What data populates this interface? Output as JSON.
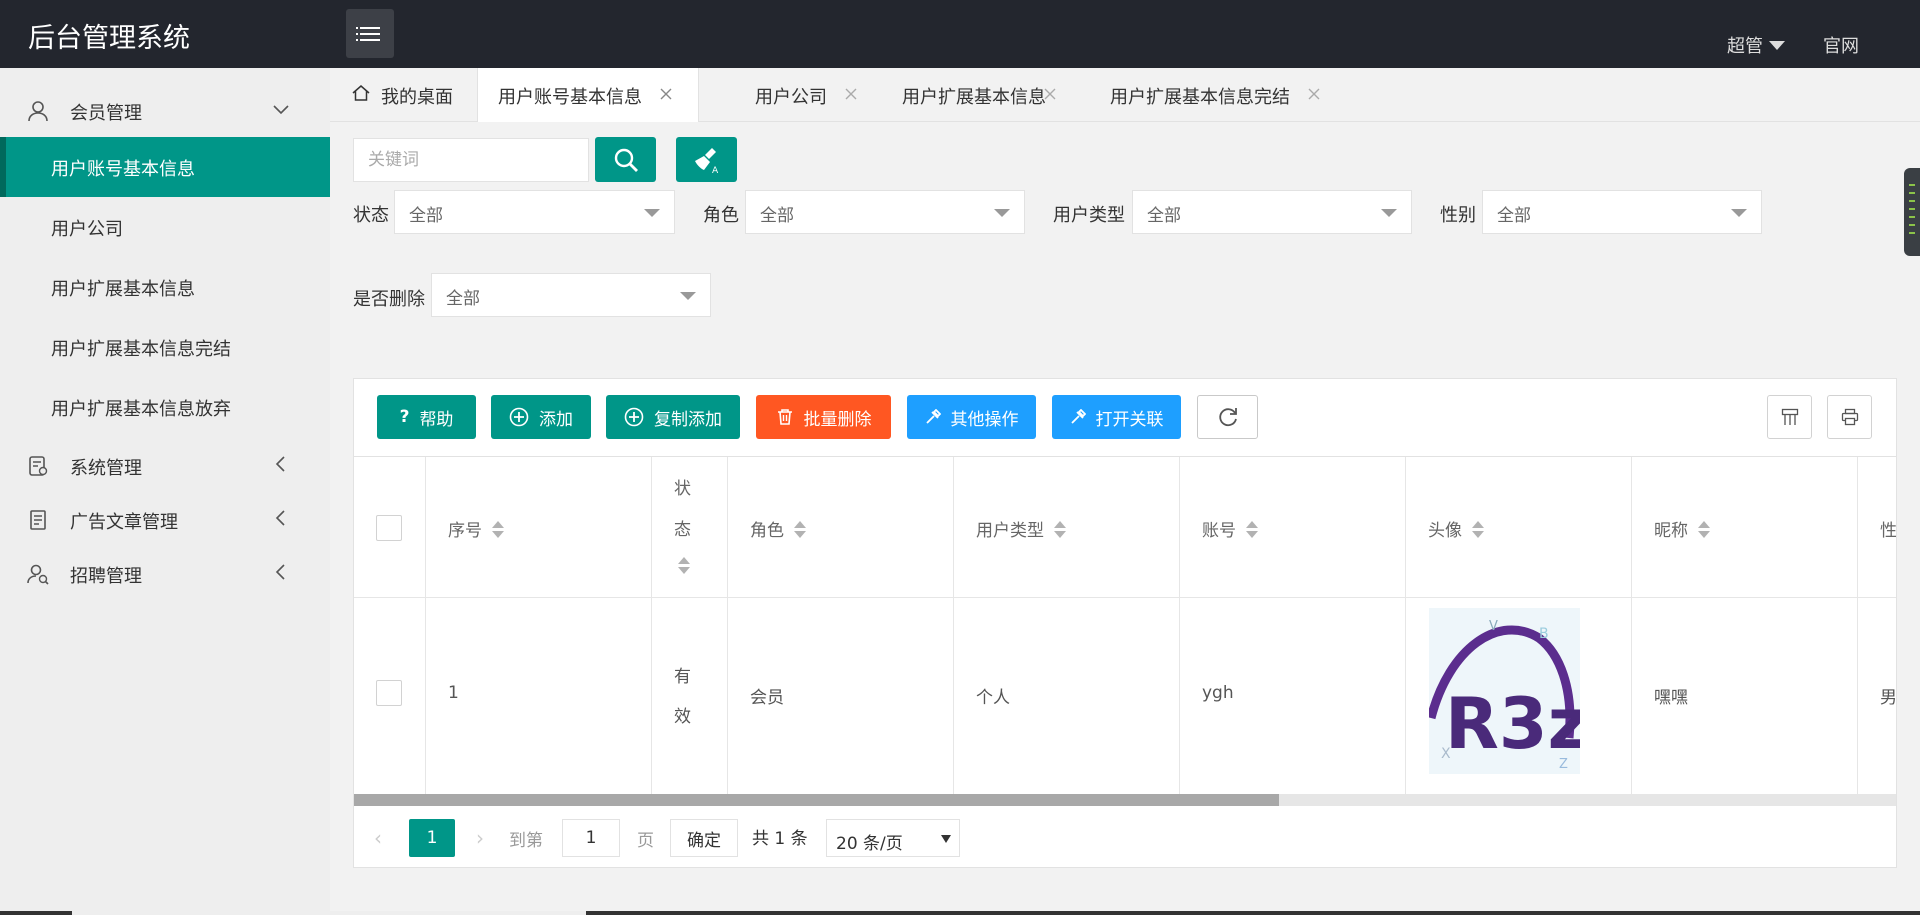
{
  "app": {
    "title": "后台管理系统",
    "user": "超管",
    "official_site": "官网"
  },
  "sidebar": {
    "groups": [
      {
        "label": "会员管理",
        "icon": "user-icon",
        "expanded": true
      },
      {
        "label": "系统管理",
        "icon": "system-icon",
        "expanded": false
      },
      {
        "label": "广告文章管理",
        "icon": "article-icon",
        "expanded": false
      },
      {
        "label": "招聘管理",
        "icon": "recruit-icon",
        "expanded": false
      }
    ],
    "member_items": [
      {
        "label": "用户账号基本信息",
        "active": true
      },
      {
        "label": "用户公司",
        "active": false
      },
      {
        "label": "用户扩展基本信息",
        "active": false
      },
      {
        "label": "用户扩展基本信息完结",
        "active": false
      },
      {
        "label": "用户扩展基本信息放弃",
        "active": false
      }
    ]
  },
  "tabs": [
    {
      "label": "我的桌面",
      "icon": "home-icon",
      "closable": false,
      "active": false
    },
    {
      "label": "用户账号基本信息",
      "closable": true,
      "active": true
    },
    {
      "label": "用户公司",
      "closable": true,
      "active": false
    },
    {
      "label": "用户扩展基本信息",
      "closable": true,
      "active": false
    },
    {
      "label": "用户扩展基本信息完结",
      "closable": true,
      "active": false
    }
  ],
  "search": {
    "placeholder": "关键词",
    "value": ""
  },
  "filters": {
    "status": {
      "label": "状态",
      "value": "全部"
    },
    "role": {
      "label": "角色",
      "value": "全部"
    },
    "user_type": {
      "label": "用户类型",
      "value": "全部"
    },
    "gender": {
      "label": "性别",
      "value": "全部"
    },
    "deleted": {
      "label": "是否删除",
      "value": "全部"
    }
  },
  "toolbar": {
    "help": "帮助",
    "add": "添加",
    "copy_add": "复制添加",
    "batch_delete": "批量删除",
    "other_ops": "其他操作",
    "open_link": "打开关联"
  },
  "table": {
    "headers": {
      "seq": "序号",
      "status_line1": "状",
      "status_line2": "态",
      "role": "角色",
      "user_type": "用户类型",
      "account": "账号",
      "avatar": "头像",
      "nickname": "昵称",
      "gender_partial": "性"
    },
    "rows": [
      {
        "seq": "1",
        "status_line1": "有",
        "status_line2": "效",
        "role": "会员",
        "user_type": "个人",
        "account": "ygh",
        "avatar_text": "R3z",
        "nickname": "嘿嘿",
        "gender_partial": "男"
      }
    ],
    "horizontal_scroll_fraction": 0.6
  },
  "pagination": {
    "current": "1",
    "goto_label": "到第",
    "goto_value": "1",
    "page_label": "页",
    "confirm": "确定",
    "total": "共 1 条",
    "page_size": "20 条/页"
  },
  "colors": {
    "primary": "#009688",
    "danger": "#ff5722",
    "info": "#1e9fff",
    "header_bg": "#23262e"
  }
}
